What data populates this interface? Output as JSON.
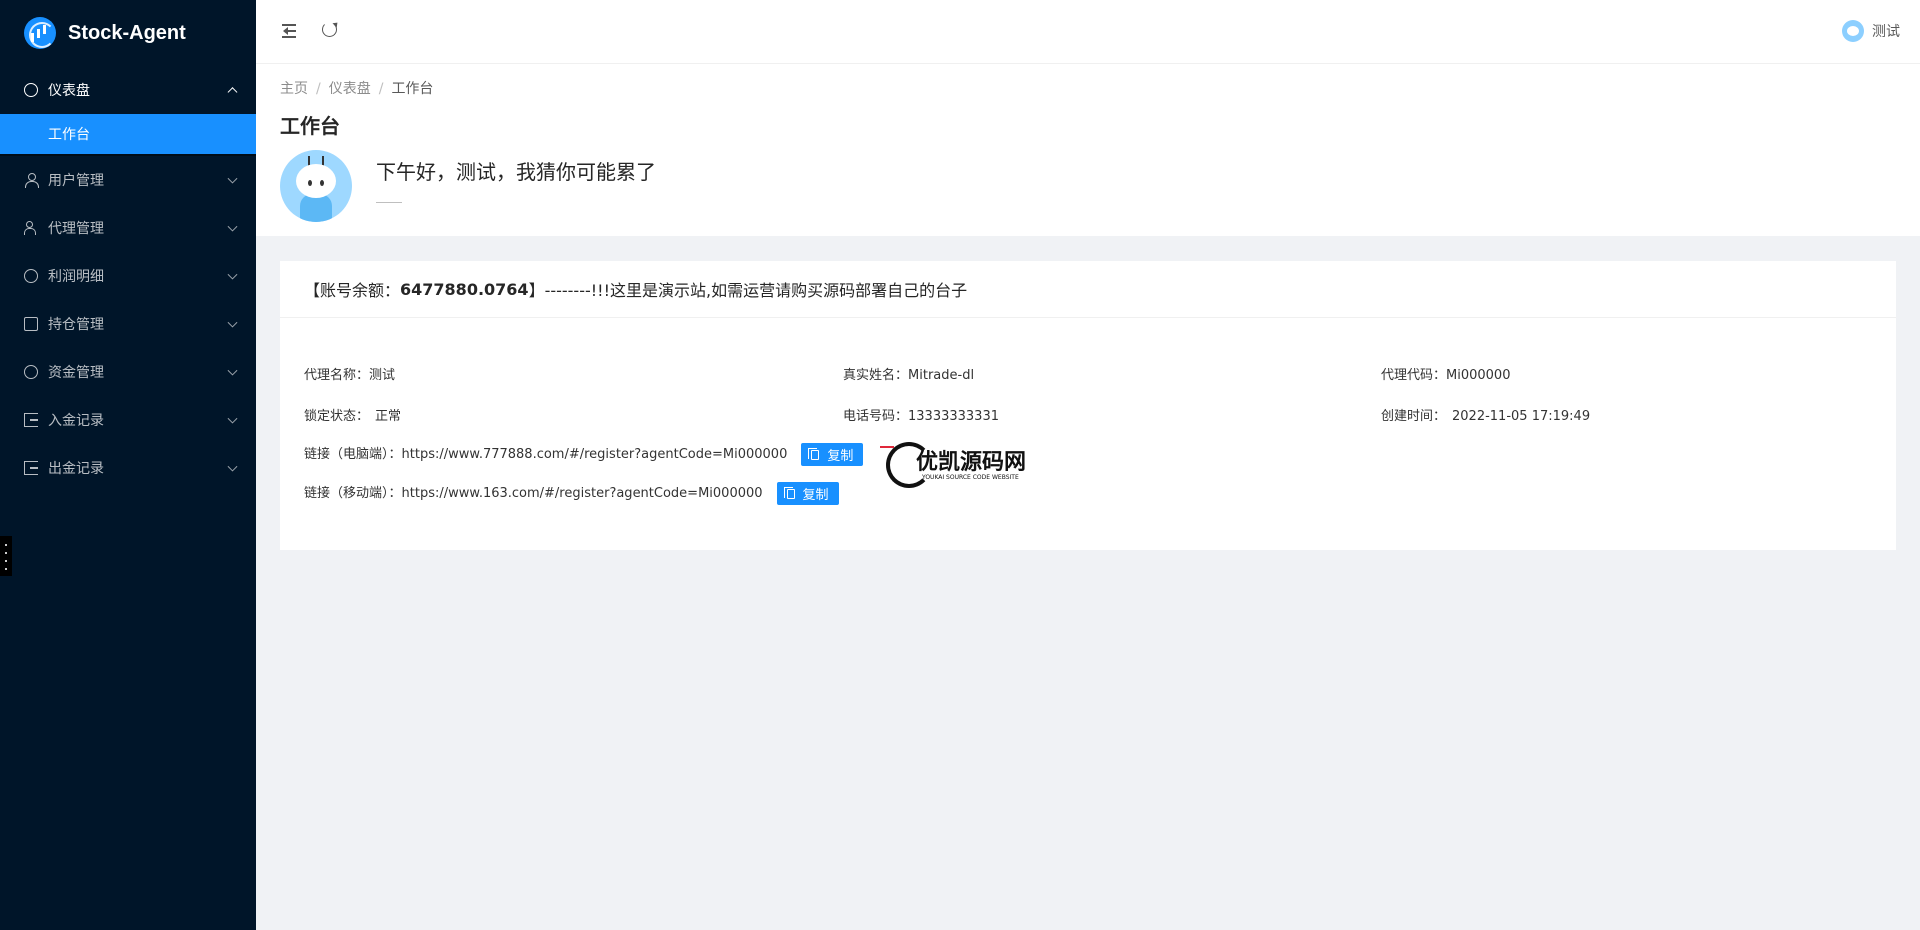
{
  "app": {
    "title": "Stock-Agent"
  },
  "sidebar": {
    "items": [
      {
        "label": "仪表盘",
        "icon": "dashboard-icon",
        "open": true
      },
      {
        "label": "工作台",
        "sub": true,
        "active": true
      },
      {
        "label": "用户管理",
        "icon": "user-icon"
      },
      {
        "label": "代理管理",
        "icon": "team-icon"
      },
      {
        "label": "利润明细",
        "icon": "profit-icon"
      },
      {
        "label": "持仓管理",
        "icon": "position-icon"
      },
      {
        "label": "资金管理",
        "icon": "fund-icon"
      },
      {
        "label": "入金记录",
        "icon": "deposit-icon"
      },
      {
        "label": "出金记录",
        "icon": "withdraw-icon"
      }
    ]
  },
  "header": {
    "user_name": "测试"
  },
  "breadcrumb": [
    "主页",
    "仪表盘",
    "工作台"
  ],
  "page": {
    "title": "工作台",
    "greeting": "下午好，测试，我猜你可能累了"
  },
  "notice": {
    "prefix": "【账号余额：",
    "balance": "6477880.0764",
    "suffix": "】--------!!!这里是演示站,如需运营请购买源码部署自己的台子"
  },
  "info": {
    "agent_name_label": "代理名称：",
    "agent_name": "测试",
    "real_name_label": "真实姓名：",
    "real_name": "Mitrade-dl",
    "agent_code_label": "代理代码：",
    "agent_code": "Mi000000",
    "lock_label": "锁定状态：",
    "lock_status": "正常",
    "phone_label": "电话号码：",
    "phone": "13333333331",
    "created_label": "创建时间：",
    "created_at": "2022-11-05 17:19:49",
    "pc_link_label": "链接（电脑端）：",
    "pc_link": "https://www.777888.com/#/register?agentCode=Mi000000",
    "mobile_link_label": "链接（移动端）：",
    "mobile_link": "https://www.163.com/#/register?agentCode=Mi000000",
    "copy_label": "复制"
  },
  "watermark": {
    "text": "优凯源码网",
    "sub": "YOUKAI SOURCE CODE WEBSITE"
  },
  "colors": {
    "sidebar_bg": "#001529",
    "primary": "#1890ff"
  }
}
